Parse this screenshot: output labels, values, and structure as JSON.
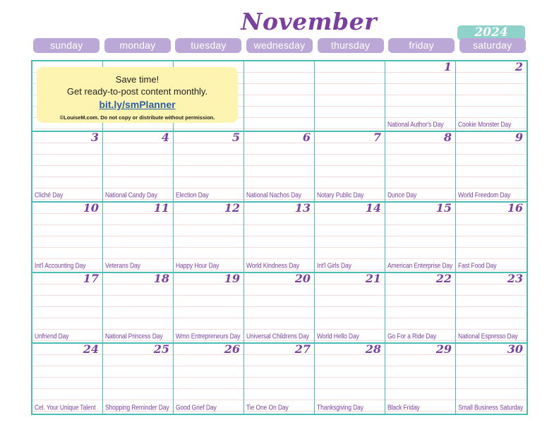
{
  "header": {
    "month": "November",
    "year": "2024",
    "month_color": "#7b3fa0",
    "year_pill_color": "#8ed2ca",
    "weekday_pill_color": "#bca8d7",
    "grid_border_color": "#4cbdb2",
    "rule_line_color": "#f6d9dc",
    "note_color": "#fcf4b0"
  },
  "weekdays": [
    {
      "label": "sunday"
    },
    {
      "label": "monday"
    },
    {
      "label": "tuesday"
    },
    {
      "label": "wednesday"
    },
    {
      "label": "thursday"
    },
    {
      "label": "friday"
    },
    {
      "label": "saturday"
    }
  ],
  "promo": {
    "line1": "Save time!",
    "line2": "Get ready-to-post content monthly.",
    "link": "bit.ly/smPlanner",
    "fineprint": "©LouiseM.com. Do not copy or distribute without permission."
  },
  "weeks": [
    [
      {
        "date": "",
        "event": ""
      },
      {
        "date": "",
        "event": ""
      },
      {
        "date": "",
        "event": ""
      },
      {
        "date": "",
        "event": ""
      },
      {
        "date": "",
        "event": ""
      },
      {
        "date": "1",
        "event": "National Author's Day"
      },
      {
        "date": "2",
        "event": "Cookie Monster Day"
      }
    ],
    [
      {
        "date": "3",
        "event": "Cliché Day"
      },
      {
        "date": "4",
        "event": "National Candy Day"
      },
      {
        "date": "5",
        "event": "Election Day"
      },
      {
        "date": "6",
        "event": "National Nachos Day"
      },
      {
        "date": "7",
        "event": "Notary Public Day"
      },
      {
        "date": "8",
        "event": "Dunce Day"
      },
      {
        "date": "9",
        "event": "World Freedom Day"
      }
    ],
    [
      {
        "date": "10",
        "event": "Int'l Accounting Day"
      },
      {
        "date": "11",
        "event": "Veterans Day"
      },
      {
        "date": "12",
        "event": "Happy Hour Day"
      },
      {
        "date": "13",
        "event": "World Kindness Day"
      },
      {
        "date": "14",
        "event": "Int'l Girls Day"
      },
      {
        "date": "15",
        "event": "American Enterprise Day"
      },
      {
        "date": "16",
        "event": "Fast Food Day"
      }
    ],
    [
      {
        "date": "17",
        "event": "Unfriend Day"
      },
      {
        "date": "18",
        "event": "National Princess Day"
      },
      {
        "date": "19",
        "event": "Wmn Entrepreneurs Day"
      },
      {
        "date": "20",
        "event": "Universal Childrens Day"
      },
      {
        "date": "21",
        "event": "World Hello Day"
      },
      {
        "date": "22",
        "event": "Go For a Ride Day"
      },
      {
        "date": "23",
        "event": "National Espresso Day"
      }
    ],
    [
      {
        "date": "24",
        "event": "Cel. Your Unique Talent"
      },
      {
        "date": "25",
        "event": "Shopping Reminder Day"
      },
      {
        "date": "26",
        "event": "Good Grief Day"
      },
      {
        "date": "27",
        "event": "Tie One On Day"
      },
      {
        "date": "28",
        "event": "Thanksgiving Day"
      },
      {
        "date": "29",
        "event": "Black Friday"
      },
      {
        "date": "30",
        "event": "Small Business Saturday"
      }
    ]
  ]
}
